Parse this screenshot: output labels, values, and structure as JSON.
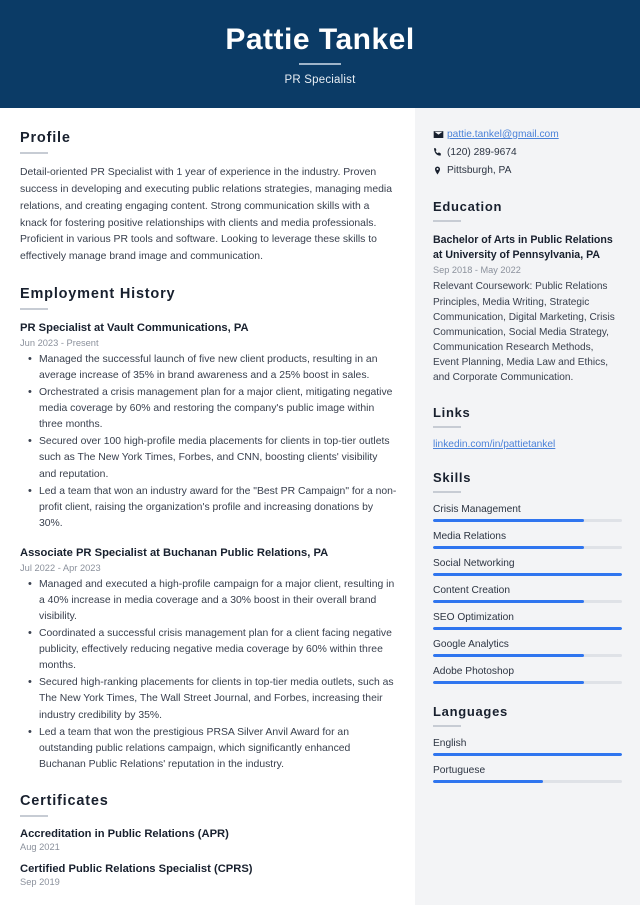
{
  "header": {
    "name": "Pattie Tankel",
    "job_title": "PR Specialist",
    "background_color": "#0b3b66"
  },
  "main": {
    "profile": {
      "heading": "Profile",
      "text": "Detail-oriented PR Specialist with 1 year of experience in the industry. Proven success in developing and executing public relations strategies, managing media relations, and creating engaging content. Strong communication skills with a knack for fostering positive relationships with clients and media professionals. Proficient in various PR tools and software. Looking to leverage these skills to effectively manage brand image and communication."
    },
    "employment": {
      "heading": "Employment History",
      "jobs": [
        {
          "title": "PR Specialist at Vault Communications, PA",
          "date": "Jun 2023 - Present",
          "bullets": [
            "Managed the successful launch of five new client products, resulting in an average increase of 35% in brand awareness and a 25% boost in sales.",
            "Orchestrated a crisis management plan for a major client, mitigating negative media coverage by 60% and restoring the company's public image within three months.",
            "Secured over 100 high-profile media placements for clients in top-tier outlets such as The New York Times, Forbes, and CNN, boosting clients' visibility and reputation.",
            "Led a team that won an industry award for the \"Best PR Campaign\" for a non-profit client, raising the organization's profile and increasing donations by 30%."
          ]
        },
        {
          "title": "Associate PR Specialist at Buchanan Public Relations, PA",
          "date": "Jul 2022 - Apr 2023",
          "bullets": [
            "Managed and executed a high-profile campaign for a major client, resulting in a 40% increase in media coverage and a 30% boost in their overall brand visibility.",
            "Coordinated a successful crisis management plan for a client facing negative publicity, effectively reducing negative media coverage by 60% within three months.",
            "Secured high-ranking placements for clients in top-tier media outlets, such as The New York Times, The Wall Street Journal, and Forbes, increasing their industry credibility by 35%.",
            "Led a team that won the prestigious PRSA Silver Anvil Award for an outstanding public relations campaign, which significantly enhanced Buchanan Public Relations' reputation in the industry."
          ]
        }
      ]
    },
    "certificates": {
      "heading": "Certificates",
      "items": [
        {
          "name": "Accreditation in Public Relations (APR)",
          "date": "Aug 2021"
        },
        {
          "name": "Certified Public Relations Specialist (CPRS)",
          "date": "Sep 2019"
        }
      ]
    }
  },
  "sidebar": {
    "contact": [
      {
        "icon": "envelope-icon",
        "text": "pattie.tankel@gmail.com",
        "is_link": true
      },
      {
        "icon": "phone-icon",
        "text": "(120) 289-9674",
        "is_link": false
      },
      {
        "icon": "location-pin-icon",
        "text": "Pittsburgh, PA",
        "is_link": false
      }
    ],
    "education": {
      "heading": "Education",
      "degree": "Bachelor of Arts in Public Relations at University of Pennsylvania, PA",
      "date": "Sep 2018 - May 2022",
      "description": "Relevant Coursework: Public Relations Principles, Media Writing, Strategic Communication, Digital Marketing, Crisis Communication, Social Media Strategy, Communication Research Methods, Event Planning, Media Law and Ethics, and Corporate Communication."
    },
    "links": {
      "heading": "Links",
      "items": [
        "linkedin.com/in/pattietankel"
      ]
    },
    "skills": {
      "heading": "Skills",
      "accent_color": "#2f75ef",
      "items": [
        {
          "label": "Crisis Management",
          "level": 80
        },
        {
          "label": "Media Relations",
          "level": 80
        },
        {
          "label": "Social Networking",
          "level": 100
        },
        {
          "label": "Content Creation",
          "level": 80
        },
        {
          "label": "SEO Optimization",
          "level": 100
        },
        {
          "label": "Google Analytics",
          "level": 80
        },
        {
          "label": "Adobe Photoshop",
          "level": 80
        }
      ]
    },
    "languages": {
      "heading": "Languages",
      "items": [
        {
          "label": "English",
          "level": 100
        },
        {
          "label": "Portuguese",
          "level": 58
        }
      ]
    }
  }
}
